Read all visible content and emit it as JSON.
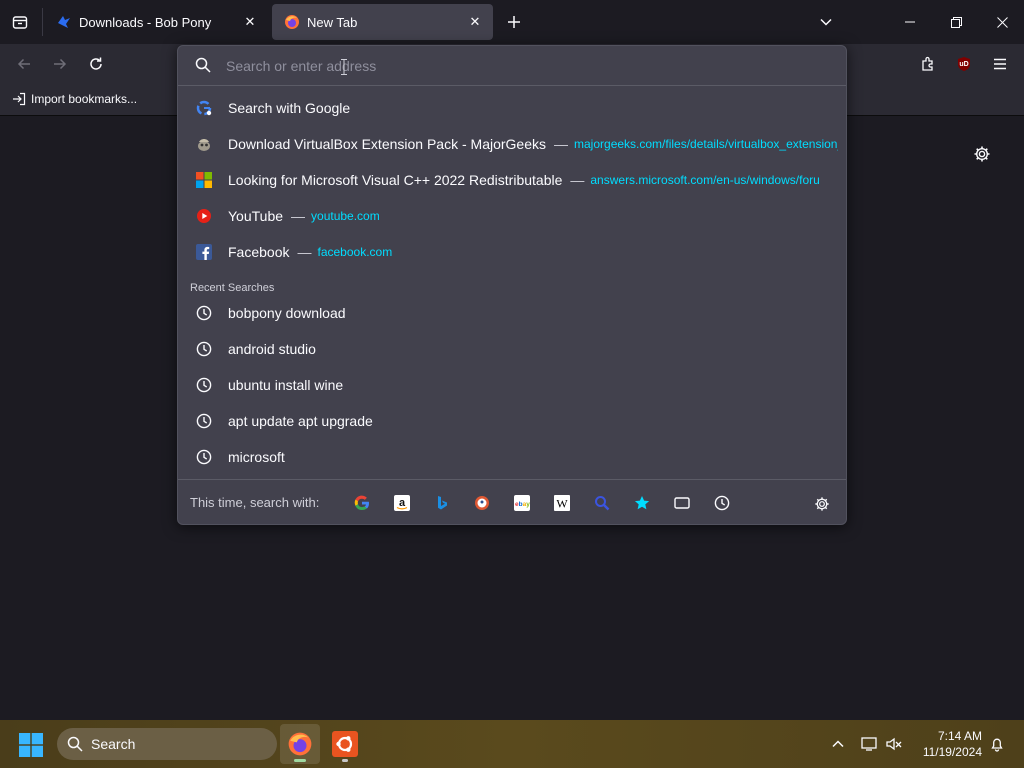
{
  "tabs": [
    {
      "title": "Downloads - Bob Pony",
      "icon": "bobpony-favicon"
    },
    {
      "title": "New Tab",
      "icon": "firefox-favicon"
    }
  ],
  "toolbar": {
    "back_icon": "back-arrow-icon",
    "forward_icon": "forward-arrow-icon",
    "reload_icon": "reload-icon",
    "extensions_icon": "extensions-icon",
    "ublock_label": "uD",
    "menu_icon": "hamburger-icon"
  },
  "bookmarks": {
    "import_label": "Import bookmarks..."
  },
  "urlbar": {
    "placeholder": "Search or enter address",
    "suggestions": [
      {
        "title": "Search with Google",
        "url": "",
        "icon": "google-icon"
      },
      {
        "title": "Download VirtualBox Extension Pack - MajorGeeks",
        "url": "majorgeeks.com/files/details/virtualbox_extension_",
        "icon": "majorgeeks-icon"
      },
      {
        "title": "Looking for Microsoft Visual C++ 2022 Redistributable",
        "url": "answers.microsoft.com/en-us/windows/foru",
        "icon": "microsoft-icon"
      },
      {
        "title": "YouTube",
        "url": "youtube.com",
        "icon": "youtube-icon"
      },
      {
        "title": "Facebook",
        "url": "facebook.com",
        "icon": "facebook-icon"
      }
    ],
    "separator": "—",
    "recent_label": "Recent Searches",
    "recent": [
      "bobpony download",
      "android studio",
      "ubuntu install wine",
      "apt update apt upgrade",
      "microsoft"
    ],
    "oneoff_label": "This time, search with:",
    "engines": [
      "google",
      "amazon",
      "bing",
      "duckduckgo",
      "ebay",
      "wikipedia",
      "search-custom",
      "bookmarks",
      "tabs",
      "history"
    ]
  },
  "taskbar": {
    "search_label": "Search",
    "time": "7:14 AM",
    "date": "11/19/2024",
    "accent": "#00ddff"
  }
}
